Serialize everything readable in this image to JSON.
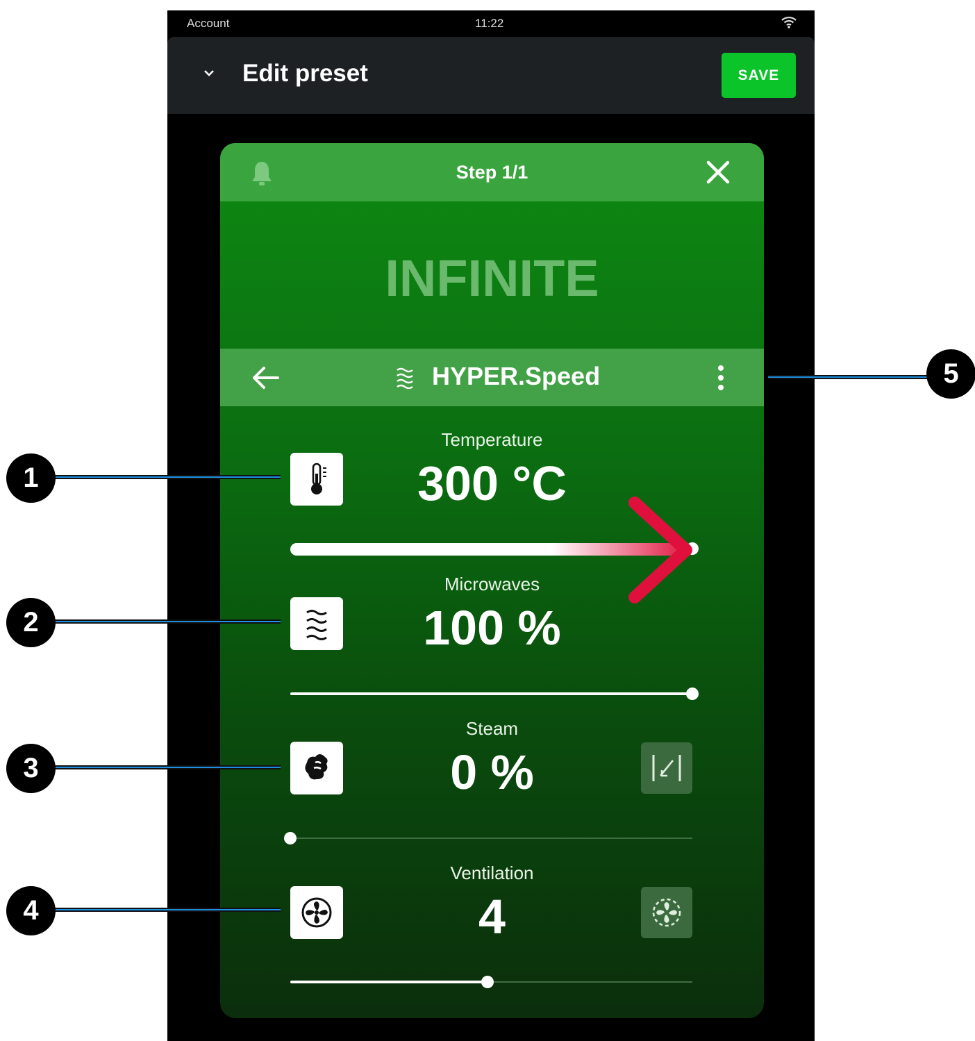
{
  "status_bar": {
    "account": "Account",
    "time": "11:22"
  },
  "app_bar": {
    "title": "Edit preset",
    "save_label": "SAVE"
  },
  "card": {
    "step": "Step 1/1",
    "duration_text": "INFINITE",
    "program": {
      "name": "HYPER.Speed"
    }
  },
  "params": {
    "temperature": {
      "label": "Temperature",
      "value": "300 °C",
      "slider_level_pct": 100
    },
    "microwaves": {
      "label": "Microwaves",
      "value": "100 %",
      "slider_level_pct": 100
    },
    "steam": {
      "label": "Steam",
      "value": "0 %",
      "slider_level_pct": 0
    },
    "ventilation": {
      "label": "Ventilation",
      "value": "4",
      "slider_level_pct": 49
    }
  },
  "callouts": [
    "1",
    "2",
    "3",
    "4",
    "5"
  ],
  "colors": {
    "save_button": "#0bc42a",
    "card_header": "#3aa53e",
    "highlight_arrow": "#e0103c",
    "callout_line": "#1e8fe0"
  },
  "icons": {
    "header": [
      "chevron-down-icon",
      "wifi-icon"
    ],
    "card": [
      "bell-icon",
      "close-icon",
      "back-arrow-icon",
      "microwave-waves-icon",
      "more-vert-icon"
    ],
    "params": [
      "thermometer-icon",
      "microwave-waves-icon",
      "steam-icon",
      "fan-icon"
    ],
    "aux": [
      "steam-injection-icon",
      "fan-auto-icon"
    ]
  }
}
